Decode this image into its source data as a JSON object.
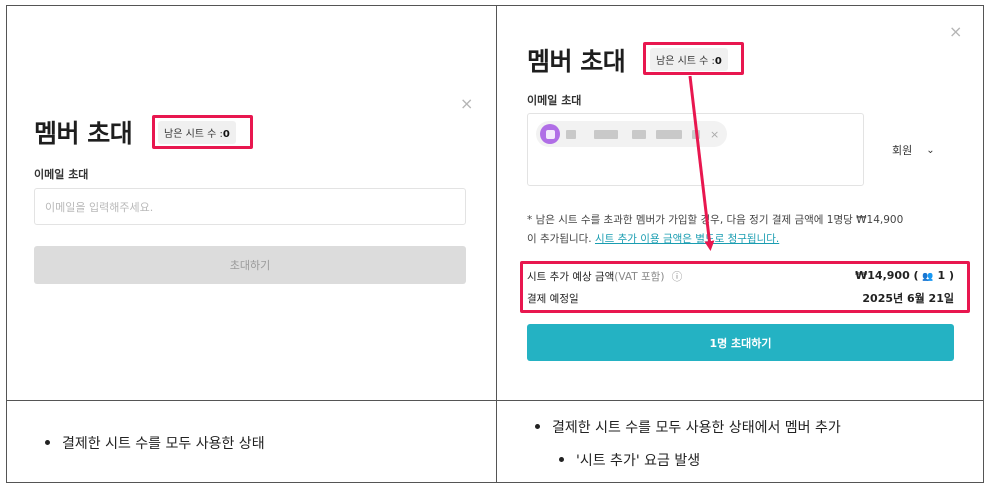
{
  "left_panel": {
    "title": "멤버 초대",
    "seat_label": "남은 시트 수 :",
    "seat_count": "0",
    "close_icon": "×",
    "email_label": "이메일 초대",
    "email_placeholder": "이메일을 입력해주세요.",
    "invite_button": "초대하기"
  },
  "right_panel": {
    "title": "멤버 초대",
    "seat_label": "남은 시트 수 :",
    "seat_count": "0",
    "close_icon": "×",
    "email_label": "이메일 초대",
    "chip_remove": "×",
    "role_value": "회원",
    "role_chevron": "⌄",
    "notice_part1": "* 남은 시트 수를 초과한 멤버가 가입할 경우, 다음 정기 결제 금액에 1명당 ₩14,900",
    "notice_part2": "이 추가됩니다. ",
    "notice_link": "시트 추가 이용 금액은 별도로 청구됩니다.",
    "cost_label": "시트 추가 예상 금액",
    "cost_vat": "(VAT 포함)",
    "info_icon": "ⓘ",
    "cost_value": "₩14,900 ( ",
    "cost_people_icon": "👥",
    "cost_people": "1 )",
    "date_label": "결제 예정일",
    "date_value": "2025년 6월 21일",
    "invite_button": "1명 초대하기"
  },
  "captions": {
    "left": "결제한 시트 수를 모두 사용한 상태",
    "right_main": "결제한 시트 수를 모두 사용한 상태에서 멤버 추가",
    "right_sub": "'시트 추가' 요금 발생"
  },
  "colors": {
    "highlight": "#e8174f",
    "primary": "#24b2c3",
    "avatar": "#b06ee6"
  }
}
